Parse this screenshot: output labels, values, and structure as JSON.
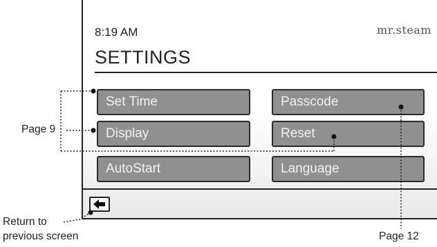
{
  "status": {
    "time": "8:19 AM",
    "brand": "mr.steam"
  },
  "page": {
    "title": "SETTINGS"
  },
  "buttons": {
    "set_time": "Set Time",
    "passcode": "Passcode",
    "display": "Display",
    "reset": "Reset",
    "autostart": "AutoStart",
    "language": "Language"
  },
  "footer": {
    "back_icon": "arrow-left-icon"
  },
  "annotations": {
    "page9": "Page 9",
    "page12": "Page 12",
    "return_line1": "Return to",
    "return_line2": "previous screen"
  }
}
